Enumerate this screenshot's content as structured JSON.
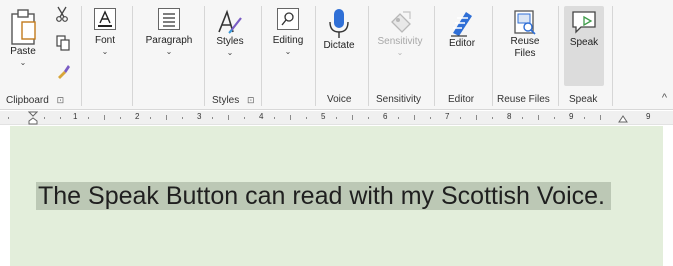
{
  "ribbon": {
    "clipboard": {
      "paste_label": "Paste",
      "group_label": "Clipboard"
    },
    "font": {
      "label": "Font"
    },
    "paragraph": {
      "label": "Paragraph"
    },
    "styles": {
      "label": "Styles",
      "group_label": "Styles"
    },
    "editing": {
      "label": "Editing"
    },
    "voice": {
      "dictate_label": "Dictate",
      "group_label": "Voice"
    },
    "sensitivity": {
      "label": "Sensitivity",
      "group_label": "Sensitivity"
    },
    "editor": {
      "label": "Editor",
      "group_label": "Editor"
    },
    "reuse_files": {
      "label_line1": "Reuse",
      "label_line2": "Files",
      "group_label": "Reuse Files"
    },
    "speak": {
      "label": "Speak",
      "group_label": "Speak"
    }
  },
  "ruler": {
    "numbers": [
      "1",
      "2",
      "3",
      "4",
      "5",
      "6",
      "7",
      "8",
      "9"
    ]
  },
  "document": {
    "text": "The Speak Button can read with my Scottish Voice."
  },
  "colors": {
    "document_background": "#e3eedb",
    "selection": "#bcc8b5",
    "ribbon_background": "#f6f6f6",
    "accent_blue": "#2f6fd6"
  }
}
